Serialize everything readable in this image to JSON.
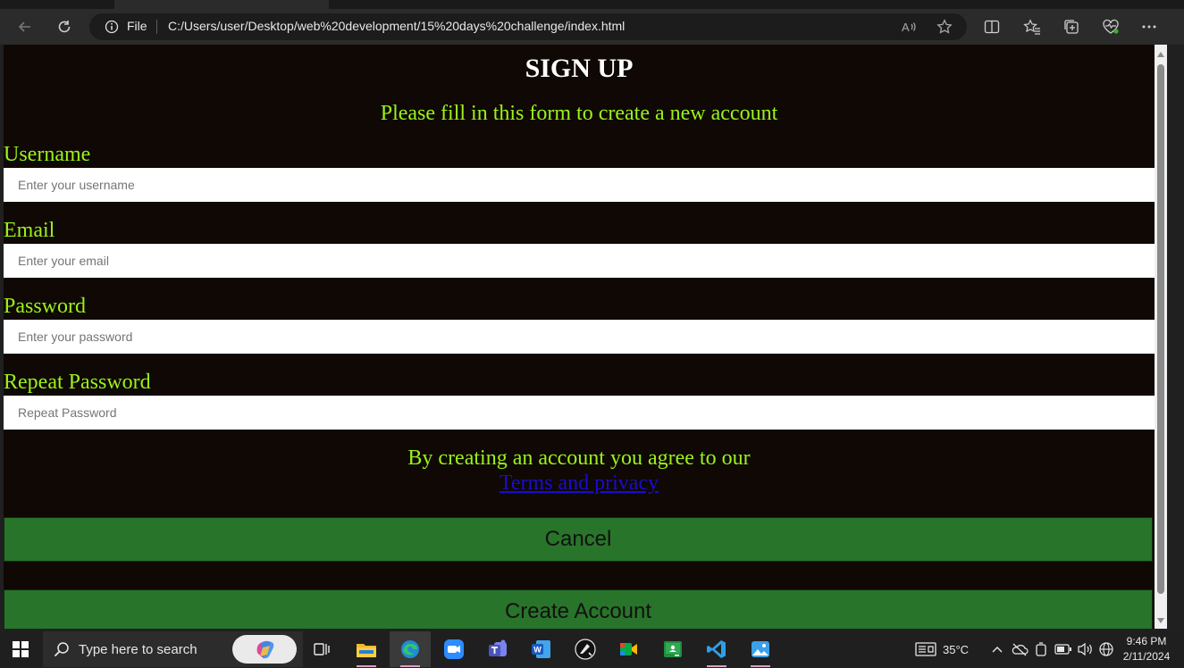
{
  "browser": {
    "scheme_label": "File",
    "url": "C:/Users/user/Desktop/web%20development/15%20days%20challenge/index.html"
  },
  "form": {
    "title": "SIGN UP",
    "subtitle": "Please fill in this form to create a new account",
    "fields": [
      {
        "label": "Username",
        "placeholder": "Enter your username"
      },
      {
        "label": "Email",
        "placeholder": "Enter your email"
      },
      {
        "label": "Password",
        "placeholder": "Enter your password"
      },
      {
        "label": "Repeat Password",
        "placeholder": "Repeat Password"
      }
    ],
    "agree_text": "By creating an account you agree to our",
    "terms_link": "Terms and privacy",
    "cancel_label": "Cancel",
    "create_label": "Create Account"
  },
  "taskbar": {
    "search_placeholder": "Type here to search",
    "weather": "35°C",
    "time": "9:46 PM",
    "date": "2/11/2024"
  },
  "colors": {
    "page_bg": "#0f0804",
    "label_green": "#9bf21a",
    "button_green": "#28742a",
    "link_blue": "#1a0dcc"
  }
}
